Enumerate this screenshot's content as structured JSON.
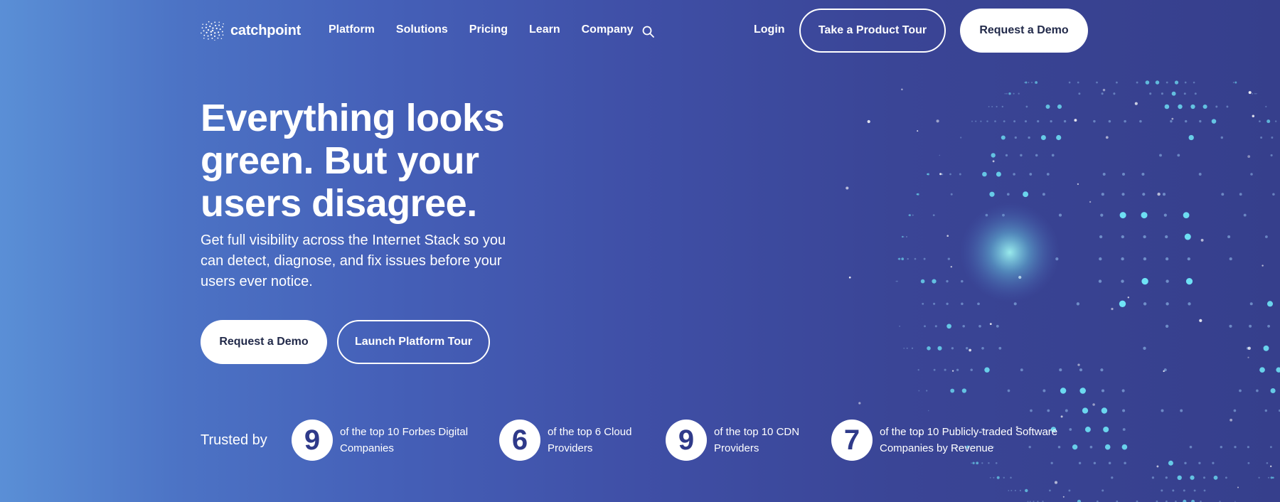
{
  "brand": {
    "name": "catchpoint"
  },
  "nav": {
    "links": [
      "Platform",
      "Solutions",
      "Pricing",
      "Learn",
      "Company"
    ],
    "login": "Login",
    "tour_button": "Take a Product Tour",
    "demo_button": "Request a Demo"
  },
  "hero": {
    "headline": "Everything looks green. But your users disagree.",
    "subtext": "Get full visibility across the Internet Stack so you can detect, diagnose, and fix issues before your users ever notice.",
    "demo_button": "Request a Demo",
    "tour_button": "Launch Platform Tour"
  },
  "trusted": {
    "label": "Trusted by",
    "stats": [
      {
        "number": "9",
        "text": "of the top 10 Forbes Digital Companies"
      },
      {
        "number": "6",
        "text": "of the top 6 Cloud Providers"
      },
      {
        "number": "9",
        "text": "of the top 10 CDN Providers"
      },
      {
        "number": "7",
        "text": "of the top 10 Publicly-traded Software Companies by Revenue"
      }
    ]
  },
  "colors": {
    "accent": "#5ee0f5",
    "button_text": "#222a4a",
    "stat_number": "#2f3a8a"
  }
}
